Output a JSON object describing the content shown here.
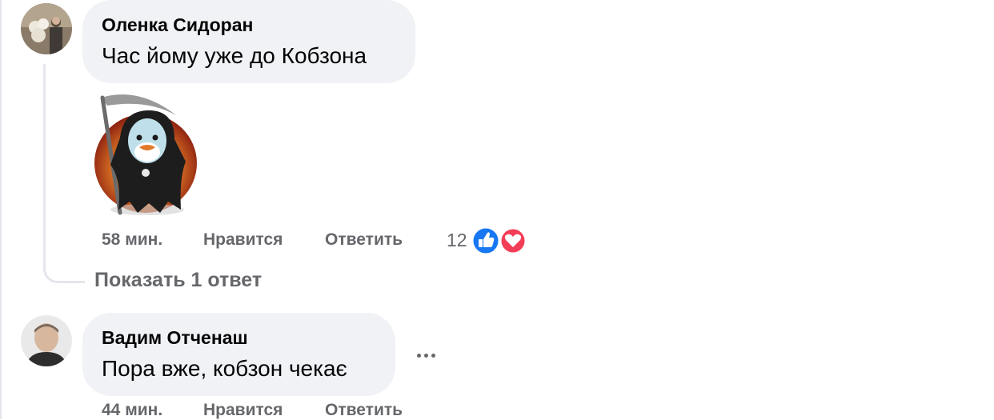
{
  "comments": [
    {
      "author": "Оленка Сидоран",
      "text": "Час йому уже до Кобзона",
      "time": "58 мин.",
      "like_label": "Нравится",
      "reply_label": "Ответить",
      "reaction_count": "12",
      "reactions": [
        "like-icon",
        "love-icon"
      ],
      "sticker": "grim-reaper-bird-sticker"
    },
    {
      "author": "Вадим Отченаш",
      "text": "Пора вже, кобзон чекає",
      "time": "44 мин.",
      "like_label": "Нравится",
      "reply_label": "Ответить"
    }
  ],
  "show_replies_label": "Показать 1 ответ",
  "colors": {
    "bubble": "#f0f2f5",
    "meta_text": "#65676b",
    "like_blue": "#1877f2",
    "love_red": "#f33e58"
  }
}
